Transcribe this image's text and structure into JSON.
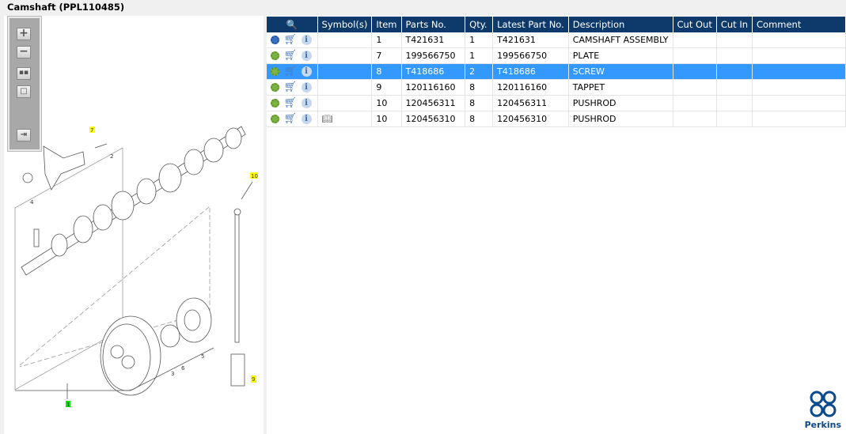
{
  "window_title": "Camshaft (PPL110485)",
  "toolbar": {
    "zoom_in": "+",
    "zoom_out": "−",
    "fit": "fit-all",
    "single": "actual-size",
    "export": "export"
  },
  "callouts": [
    "7",
    "2",
    "4",
    "10",
    "1",
    "3",
    "6",
    "5",
    "9"
  ],
  "table": {
    "headers": [
      "",
      "Symbol(s)",
      "Item",
      "Parts No.",
      "Qty.",
      "Latest Part No.",
      "Description",
      "Cut Out",
      "Cut In",
      "Comment"
    ],
    "rows": [
      {
        "item": "1",
        "parts_no": "T421631",
        "qty": "1",
        "latest": "T421631",
        "description": "CAMSHAFT ASSEMBLY",
        "icon": "assembly-gears-icon",
        "symbol": ""
      },
      {
        "item": "7",
        "parts_no": "199566750",
        "qty": "1",
        "latest": "199566750",
        "description": "PLATE",
        "icon": "gear-icon",
        "symbol": ""
      },
      {
        "item": "8",
        "parts_no": "T418686",
        "qty": "2",
        "latest": "T418686",
        "description": "SCREW",
        "icon": "gear-icon",
        "symbol": "",
        "selected": true
      },
      {
        "item": "9",
        "parts_no": "120116160",
        "qty": "8",
        "latest": "120116160",
        "description": "TAPPET",
        "icon": "gear-icon",
        "symbol": ""
      },
      {
        "item": "10",
        "parts_no": "120456311",
        "qty": "8",
        "latest": "120456311",
        "description": "PUSHROD",
        "icon": "gear-icon",
        "symbol": ""
      },
      {
        "item": "10",
        "parts_no": "120456310",
        "qty": "8",
        "latest": "120456310",
        "description": "PUSHROD",
        "icon": "gear-icon",
        "symbol": "book-search-icon"
      }
    ]
  },
  "colors": {
    "header": "#0e3a6b",
    "selected": "#3399ff",
    "callout_highlight": "#ffff00",
    "callout_current": "#00e000"
  },
  "brand": "Perkins"
}
